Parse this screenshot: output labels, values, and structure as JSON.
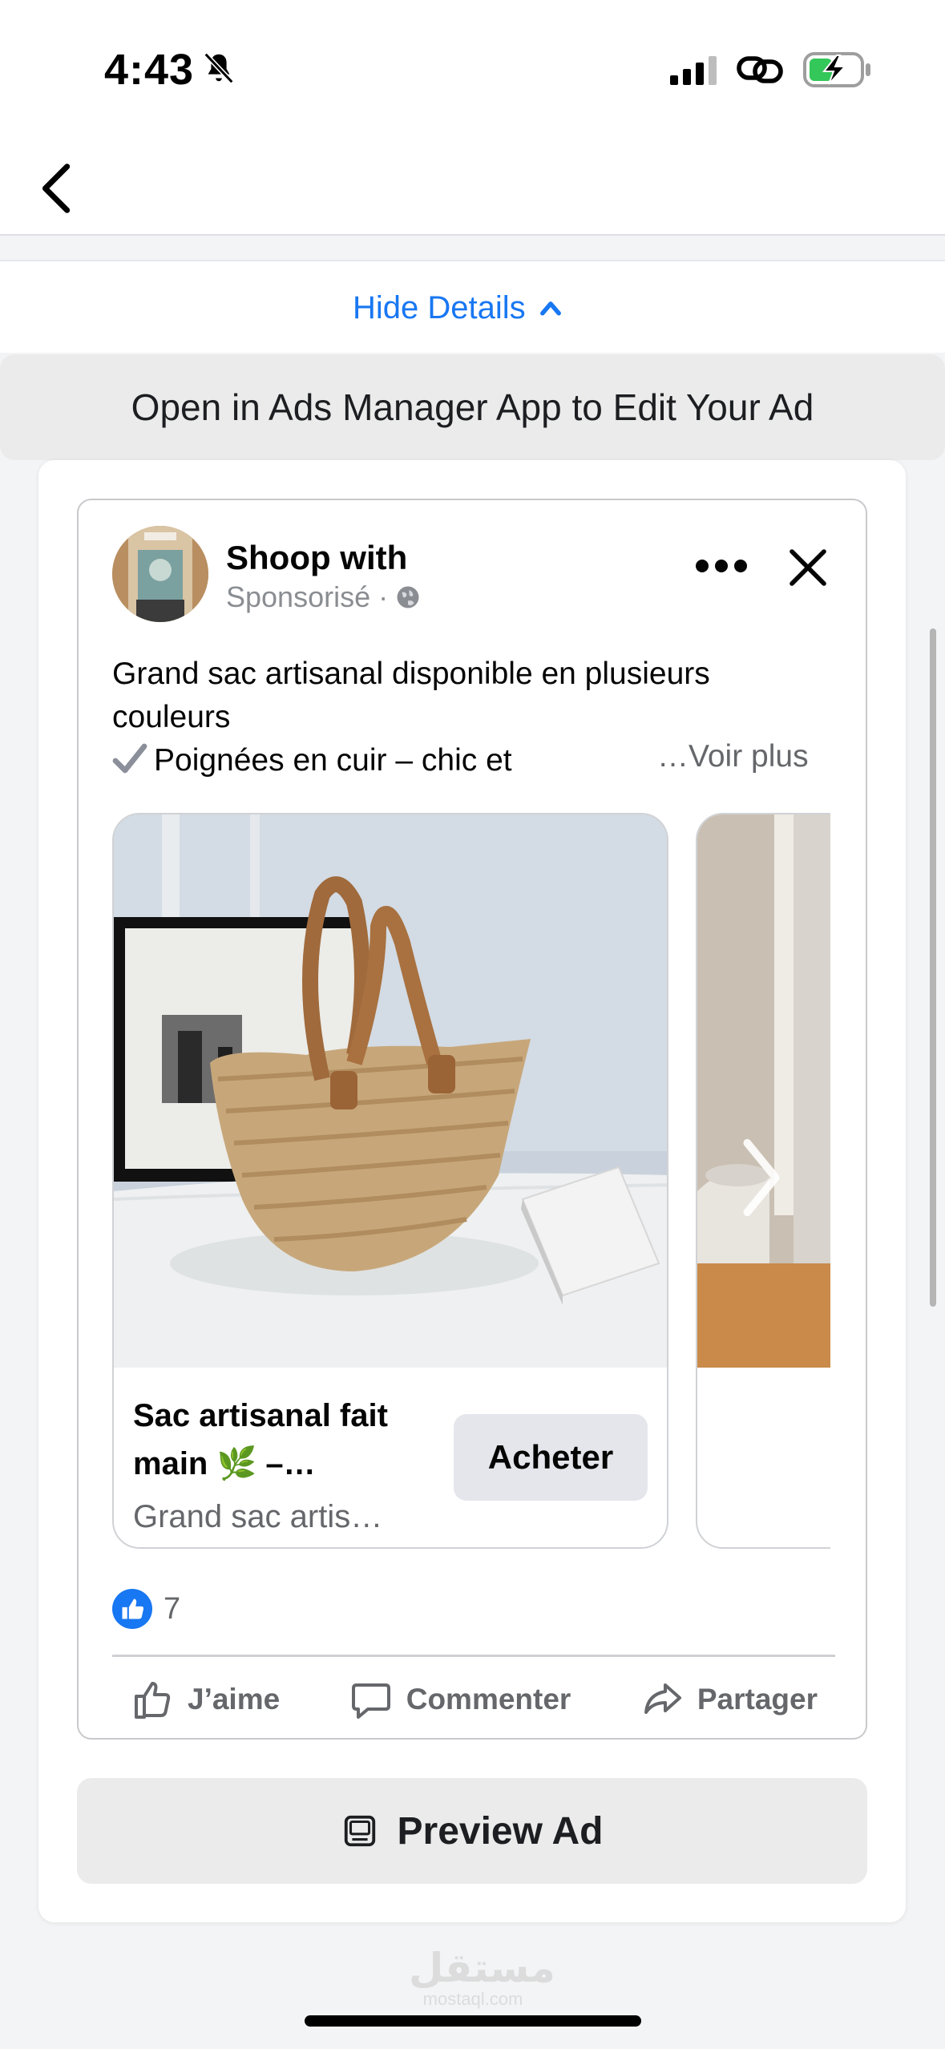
{
  "status_bar": {
    "time": "4:43",
    "icons": [
      "bell-off-icon",
      "cellular-signal-icon",
      "link-icon",
      "battery-charging-icon"
    ]
  },
  "nav": {
    "back_icon": "chevron-left-icon"
  },
  "details": {
    "hide_label": "Hide Details",
    "icon": "chevron-up-icon",
    "accent_color": "#1877f2"
  },
  "banner": {
    "text": "Open in Ads Manager App to Edit Your Ad"
  },
  "post": {
    "page_name": "Shoop with",
    "sponsored": "Sponsorisé ·",
    "text_line_1": "Grand sac artisanal disponible en plusieurs",
    "text_line_2": "couleurs",
    "text_line_3": "Poignées en cuir – chic et",
    "see_more": "…Voir plus",
    "carousel": [
      {
        "title": "Sac artisanal fait main 🌿 –…",
        "description": "Grand sac artis…",
        "cta": "Acheter"
      }
    ],
    "reaction_count": "7",
    "actions": {
      "like": "J’aime",
      "comment": "Commenter",
      "share": "Partager"
    }
  },
  "preview": {
    "label": "Preview Ad"
  },
  "watermark": {
    "arabic": "مستقل",
    "latin": "mostaql.com"
  }
}
